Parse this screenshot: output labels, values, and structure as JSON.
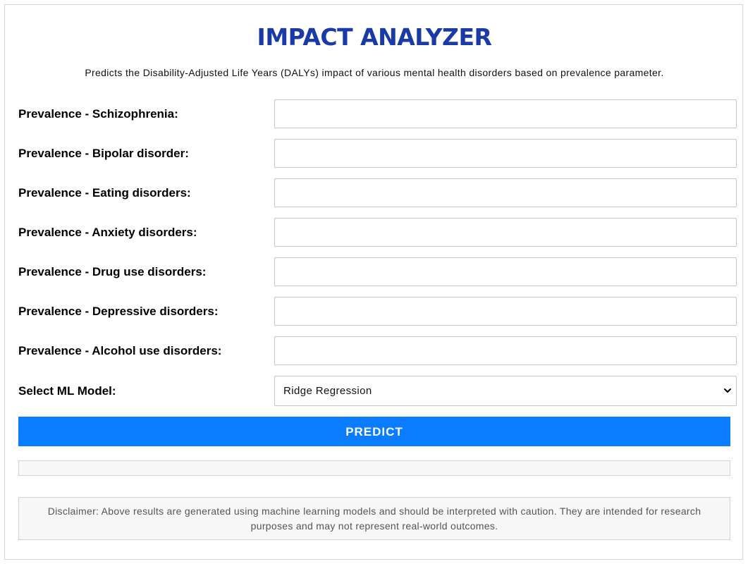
{
  "header": {
    "title": "IMPACT ANALYZER",
    "subtitle": "Predicts the Disability-Adjusted Life Years (DALYs) impact of various mental health disorders based on prevalence parameter."
  },
  "form": {
    "fields": [
      {
        "label": "Prevalence - Schizophrenia:",
        "value": ""
      },
      {
        "label": "Prevalence - Bipolar disorder:",
        "value": ""
      },
      {
        "label": "Prevalence - Eating disorders:",
        "value": ""
      },
      {
        "label": "Prevalence - Anxiety disorders:",
        "value": ""
      },
      {
        "label": "Prevalence - Drug use disorders:",
        "value": ""
      },
      {
        "label": "Prevalence - Depressive disorders:",
        "value": ""
      },
      {
        "label": "Prevalence - Alcohol use disorders:",
        "value": ""
      }
    ],
    "model": {
      "label": "Select ML Model:",
      "selected": "Ridge Regression"
    },
    "predict_label": "PREDICT"
  },
  "result": {
    "text": ""
  },
  "disclaimer": {
    "text": "Disclaimer: Above results are generated using machine learning models and should be interpreted with caution. They are intended for research purposes and may not represent real-world outcomes."
  },
  "colors": {
    "title": "#1a3aa8",
    "button": "#0a7cff"
  },
  "icons": {
    "select_arrow": "chevron-down-icon"
  }
}
